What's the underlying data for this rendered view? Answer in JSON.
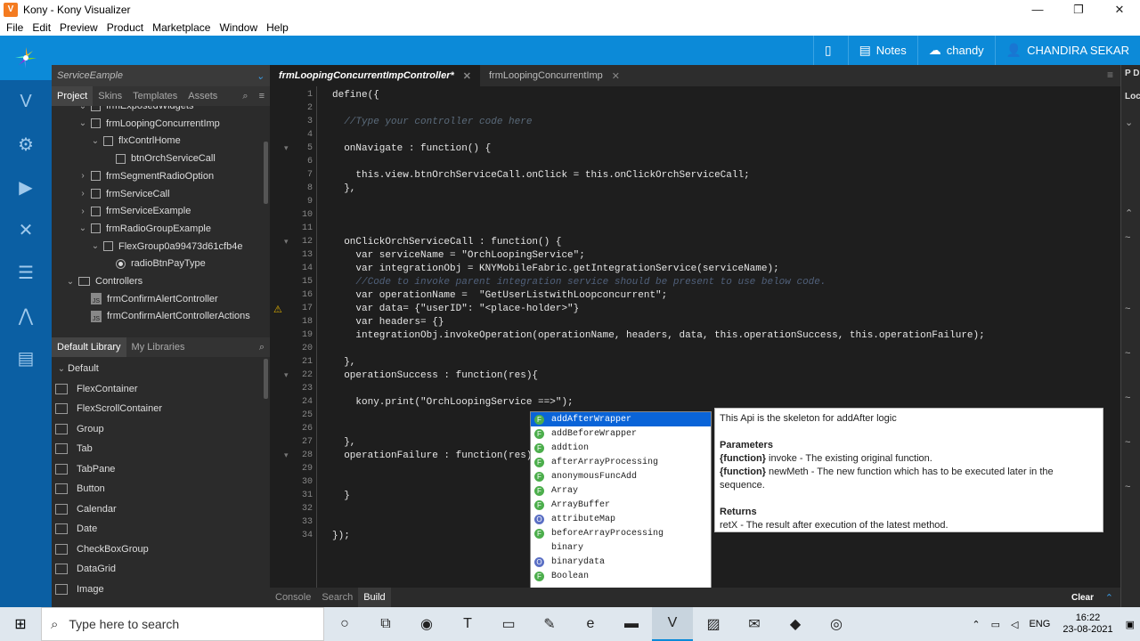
{
  "window": {
    "title": "Kony - Kony Visualizer",
    "logo": "V",
    "minimize": "—",
    "restore": "❐",
    "close": "✕"
  },
  "menu": [
    "File",
    "Edit",
    "Preview",
    "Product",
    "Marketplace",
    "Window",
    "Help"
  ],
  "header": {
    "notes": "Notes",
    "cloud_user": "chandy",
    "user_name": "CHANDIRA SEKAR"
  },
  "project": {
    "title": "ServiceEample",
    "tabs": [
      "Project",
      "Skins",
      "Templates",
      "Assets"
    ],
    "tree": [
      {
        "indent": 2,
        "arrow": "⌄",
        "icon": "box",
        "label": "frmExposedWidgets"
      },
      {
        "indent": 2,
        "arrow": "⌄",
        "icon": "box",
        "label": "frmLoopingConcurrentImp"
      },
      {
        "indent": 3,
        "arrow": "⌄",
        "icon": "box",
        "label": "flxContrlHome"
      },
      {
        "indent": 4,
        "arrow": "",
        "icon": "box",
        "label": "btnOrchServiceCall"
      },
      {
        "indent": 2,
        "arrow": "›",
        "icon": "box",
        "label": "frmSegmentRadioOption"
      },
      {
        "indent": 2,
        "arrow": "›",
        "icon": "box",
        "label": "frmServiceCall"
      },
      {
        "indent": 2,
        "arrow": "›",
        "icon": "box",
        "label": "frmServiceExample"
      },
      {
        "indent": 2,
        "arrow": "⌄",
        "icon": "box",
        "label": "frmRadioGroupExample"
      },
      {
        "indent": 3,
        "arrow": "⌄",
        "icon": "box",
        "label": "FlexGroup0a99473d61cfb4e"
      },
      {
        "indent": 4,
        "arrow": "",
        "icon": "radio",
        "label": "radioBtnPayType"
      },
      {
        "indent": 1,
        "arrow": "⌄",
        "icon": "folder",
        "label": "Controllers"
      },
      {
        "indent": 2,
        "arrow": "",
        "icon": "js",
        "label": "frmConfirmAlertController"
      },
      {
        "indent": 2,
        "arrow": "",
        "icon": "js",
        "label": "frmConfirmAlertControllerActions"
      }
    ]
  },
  "library": {
    "tabs": [
      "Default Library",
      "My Libraries"
    ],
    "group": "Default",
    "items": [
      "FlexContainer",
      "FlexScrollContainer",
      "Group",
      "Tab",
      "TabPane",
      "Button",
      "Calendar",
      "Date",
      "CheckBoxGroup",
      "DataGrid",
      "Image"
    ]
  },
  "editor": {
    "tabs": [
      {
        "label": "frmLoopingConcurrentImpController*",
        "active": true
      },
      {
        "label": "frmLoopingConcurrentImp",
        "active": false
      }
    ],
    "lines": [
      {
        "n": "1",
        "text": "define({",
        "cls": "k"
      },
      {
        "n": "2",
        "text": "",
        "cls": "k"
      },
      {
        "n": "3",
        "text": "  //Type your controller code here",
        "cls": "cm"
      },
      {
        "n": "4",
        "text": "",
        "cls": "k"
      },
      {
        "n": "5",
        "text": "  onNavigate : function() {",
        "cls": "k"
      },
      {
        "n": "6",
        "text": "",
        "cls": "k"
      },
      {
        "n": "7",
        "text": "    this.view.btnOrchServiceCall.onClick = this.onClickOrchServiceCall;",
        "cls": "k"
      },
      {
        "n": "8",
        "text": "  },",
        "cls": "k"
      },
      {
        "n": "9",
        "text": "",
        "cls": "k"
      },
      {
        "n": "10",
        "text": "",
        "cls": "k"
      },
      {
        "n": "11",
        "text": "",
        "cls": "k"
      },
      {
        "n": "12",
        "text": "  onClickOrchServiceCall : function() {",
        "cls": "k"
      },
      {
        "n": "13",
        "text": "    var serviceName = \"OrchLoopingService\";",
        "cls": "k"
      },
      {
        "n": "14",
        "text": "    var integrationObj = KNYMobileFabric.getIntegrationService(serviceName);",
        "cls": "k"
      },
      {
        "n": "15",
        "text": "    //Code to invoke parent integration service should be present to use below code.",
        "cls": "cm2"
      },
      {
        "n": "16",
        "text": "    var operationName =  \"GetUserListwithLoopconcurrent\";",
        "cls": "k"
      },
      {
        "n": "17",
        "text": "    var data= {\"userID\": \"<place-holder>\"}",
        "cls": "k"
      },
      {
        "n": "18",
        "text": "    var headers= {}",
        "cls": "k"
      },
      {
        "n": "19",
        "text": "    integrationObj.invokeOperation(operationName, headers, data, this.operationSuccess, this.operationFailure);",
        "cls": "k"
      },
      {
        "n": "20",
        "text": "",
        "cls": "k"
      },
      {
        "n": "21",
        "text": "  },",
        "cls": "k"
      },
      {
        "n": "22",
        "text": "  operationSuccess : function(res){",
        "cls": "k"
      },
      {
        "n": "23",
        "text": "",
        "cls": "k"
      },
      {
        "n": "24",
        "text": "    kony.print(\"OrchLoopingService ==>\");",
        "cls": "k"
      },
      {
        "n": "25",
        "text": "",
        "cls": "k"
      },
      {
        "n": "26",
        "text": "",
        "cls": "k"
      },
      {
        "n": "27",
        "text": "  },",
        "cls": "k"
      },
      {
        "n": "28",
        "text": "  operationFailure : function(res){",
        "cls": "k"
      },
      {
        "n": "29",
        "text": "",
        "cls": "k"
      },
      {
        "n": "30",
        "text": "",
        "cls": "k"
      },
      {
        "n": "31",
        "text": "  }",
        "cls": "k"
      },
      {
        "n": "32",
        "text": "",
        "cls": "k"
      },
      {
        "n": "33",
        "text": "",
        "cls": "k"
      },
      {
        "n": "34",
        "text": "});",
        "cls": "k"
      }
    ]
  },
  "autocomplete": {
    "items": [
      {
        "label": "addAfterWrapper",
        "badge": "F",
        "selected": true
      },
      {
        "label": "addBeforeWrapper",
        "badge": "F"
      },
      {
        "label": "addtion",
        "badge": "F"
      },
      {
        "label": "afterArrayProcessing",
        "badge": "F"
      },
      {
        "label": "anonymousFuncAdd",
        "badge": "F"
      },
      {
        "label": "Array",
        "badge": "F"
      },
      {
        "label": "ArrayBuffer",
        "badge": "F"
      },
      {
        "label": "attributeMap",
        "badge": "O"
      },
      {
        "label": "beforeArrayProcessing",
        "badge": "F"
      },
      {
        "label": "binary",
        "badge": ""
      },
      {
        "label": "binarydata",
        "badge": "O"
      },
      {
        "label": "Boolean",
        "badge": "F"
      }
    ]
  },
  "doc": {
    "summary": "This Api is the skeleton for addAfter logic",
    "params_title": "Parameters",
    "param1_type": "{function}",
    "param1_text": " invoke  - The existing original function.",
    "param2_type": "{function}",
    "param2_text": " newMeth  - The new function which has to be executed later in the sequence.",
    "returns_title": "Returns",
    "returns_text": "retX    - The result after execution of the latest method."
  },
  "bottom": {
    "tabs": [
      "Console",
      "Search",
      "Build"
    ],
    "active": "Build",
    "clear": "Clear"
  },
  "right_panel": {
    "top_label": "P D",
    "sub_label": "Loc"
  },
  "taskbar": {
    "search_placeholder": "Type here to search",
    "lang": "ENG",
    "time": "16:22",
    "date": "23-08-2021"
  }
}
